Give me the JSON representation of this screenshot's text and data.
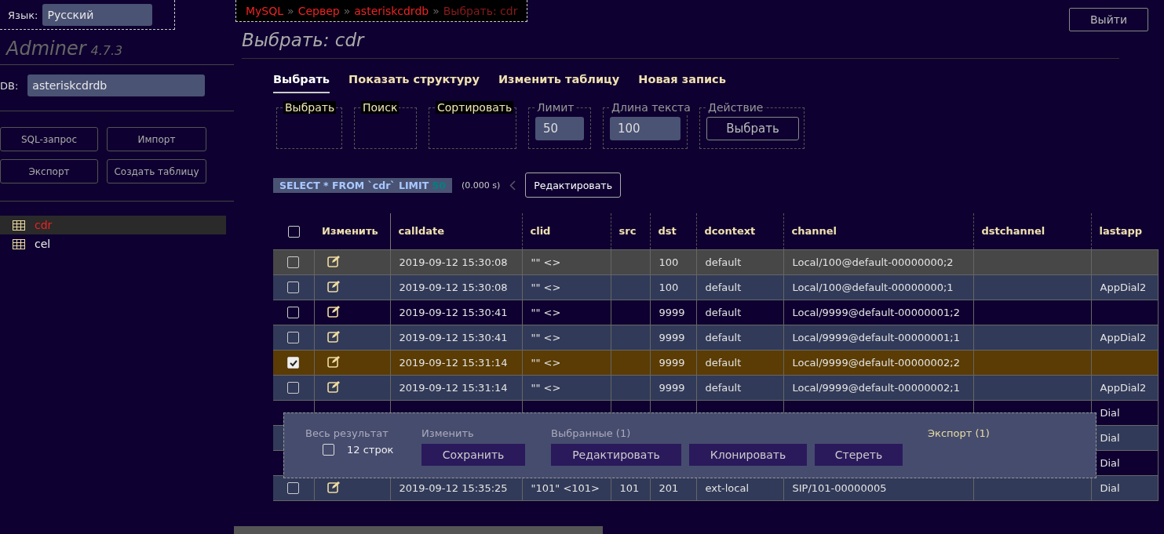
{
  "sidebar": {
    "language": {
      "label": "Язык:",
      "value": "Русский"
    },
    "brand": {
      "name": "Adminer",
      "version": "4.7.3"
    },
    "db": {
      "label": "DB:",
      "value": "asteriskcdrdb"
    },
    "buttons": [
      "SQL-запрос",
      "Импорт",
      "Экспорт",
      "Создать таблицу"
    ],
    "tables": [
      {
        "name": "cdr",
        "selected": true
      },
      {
        "name": "cel",
        "selected": false
      }
    ]
  },
  "breadcrumb": {
    "separator": "»",
    "items": [
      {
        "label": "MySQL",
        "current": false
      },
      {
        "label": "Сервер",
        "current": false
      },
      {
        "label": "asteriskcdrdb",
        "current": false
      },
      {
        "label": "Выбрать: cdr",
        "current": true
      }
    ]
  },
  "logout": "Выйти",
  "title": "Выбрать: cdr",
  "tabs": [
    {
      "label": "Выбрать",
      "selected": true
    },
    {
      "label": "Показать структуру",
      "selected": false
    },
    {
      "label": "Изменить таблицу",
      "selected": false
    },
    {
      "label": "Новая запись",
      "selected": false
    }
  ],
  "filters": [
    {
      "legend": "Выбрать",
      "kind": "empty",
      "highlighted": true
    },
    {
      "legend": "Поиск",
      "kind": "empty",
      "highlighted": true
    },
    {
      "legend": "Сортировать",
      "kind": "empty",
      "highlighted": true
    },
    {
      "legend": "Лимит",
      "kind": "input",
      "value": "50",
      "highlighted": false
    },
    {
      "legend": "Длина текста",
      "kind": "input",
      "value": "100",
      "highlighted": false
    },
    {
      "legend": "Действие",
      "kind": "button",
      "value": "Выбрать",
      "highlighted": false
    }
  ],
  "query": {
    "sql": "SELECT * FROM `cdr` LIMIT",
    "limit": "50",
    "time": "(0.000 s)",
    "edit": "Редактировать"
  },
  "table": {
    "select_all": false,
    "edit_header": "Изменить",
    "columns": [
      "calldate",
      "clid",
      "src",
      "dst",
      "dcontext",
      "channel",
      "dstchannel",
      "lastapp"
    ],
    "rows": [
      {
        "selected": false,
        "hovered": true,
        "cells": [
          "2019-09-12 15:30:08",
          "\"\" <>",
          null,
          "100",
          "default",
          "Local/100@default-00000000;2",
          null,
          null
        ]
      },
      {
        "selected": false,
        "hovered": false,
        "cells": [
          "2019-09-12 15:30:08",
          "\"\" <>",
          null,
          "100",
          "default",
          "Local/100@default-00000000;1",
          null,
          "AppDial2"
        ]
      },
      {
        "selected": false,
        "hovered": false,
        "cells": [
          "2019-09-12 15:30:41",
          "\"\" <>",
          null,
          "9999",
          "default",
          "Local/9999@default-00000001;2",
          null,
          null
        ]
      },
      {
        "selected": false,
        "hovered": false,
        "cells": [
          "2019-09-12 15:30:41",
          "\"\" <>",
          null,
          "9999",
          "default",
          "Local/9999@default-00000001;1",
          null,
          "AppDial2"
        ]
      },
      {
        "selected": true,
        "hovered": false,
        "cells": [
          "2019-09-12 15:31:14",
          "\"\" <>",
          null,
          "9999",
          "default",
          "Local/9999@default-00000002;2",
          null,
          null
        ]
      },
      {
        "selected": false,
        "hovered": false,
        "cells": [
          "2019-09-12 15:31:14",
          "\"\" <>",
          null,
          "9999",
          "default",
          "Local/9999@default-00000002;1",
          null,
          "AppDial2"
        ]
      },
      {
        "selected": false,
        "hovered": false,
        "cells": [
          null,
          null,
          null,
          null,
          null,
          null,
          null,
          "Dial"
        ]
      },
      {
        "selected": false,
        "hovered": false,
        "cells": [
          null,
          null,
          null,
          null,
          null,
          null,
          null,
          "Dial"
        ]
      },
      {
        "selected": false,
        "hovered": false,
        "cells": [
          null,
          null,
          null,
          null,
          null,
          null,
          null,
          "Dial"
        ]
      },
      {
        "selected": false,
        "hovered": false,
        "cells": [
          "2019-09-12 15:35:25",
          "\"101\" <101>",
          "101",
          "201",
          "ext-local",
          "SIP/101-00000005",
          null,
          "Dial"
        ]
      }
    ]
  },
  "footer": {
    "whole_result": {
      "legend": "Весь результат",
      "checked": false,
      "label": "12 строк"
    },
    "edit": {
      "legend": "Изменить",
      "button": "Сохранить"
    },
    "selected": {
      "legend": "Выбранные (1)",
      "buttons": [
        "Редактировать",
        "Клонировать",
        "Стереть"
      ]
    },
    "export": "Экспорт (1)"
  }
}
